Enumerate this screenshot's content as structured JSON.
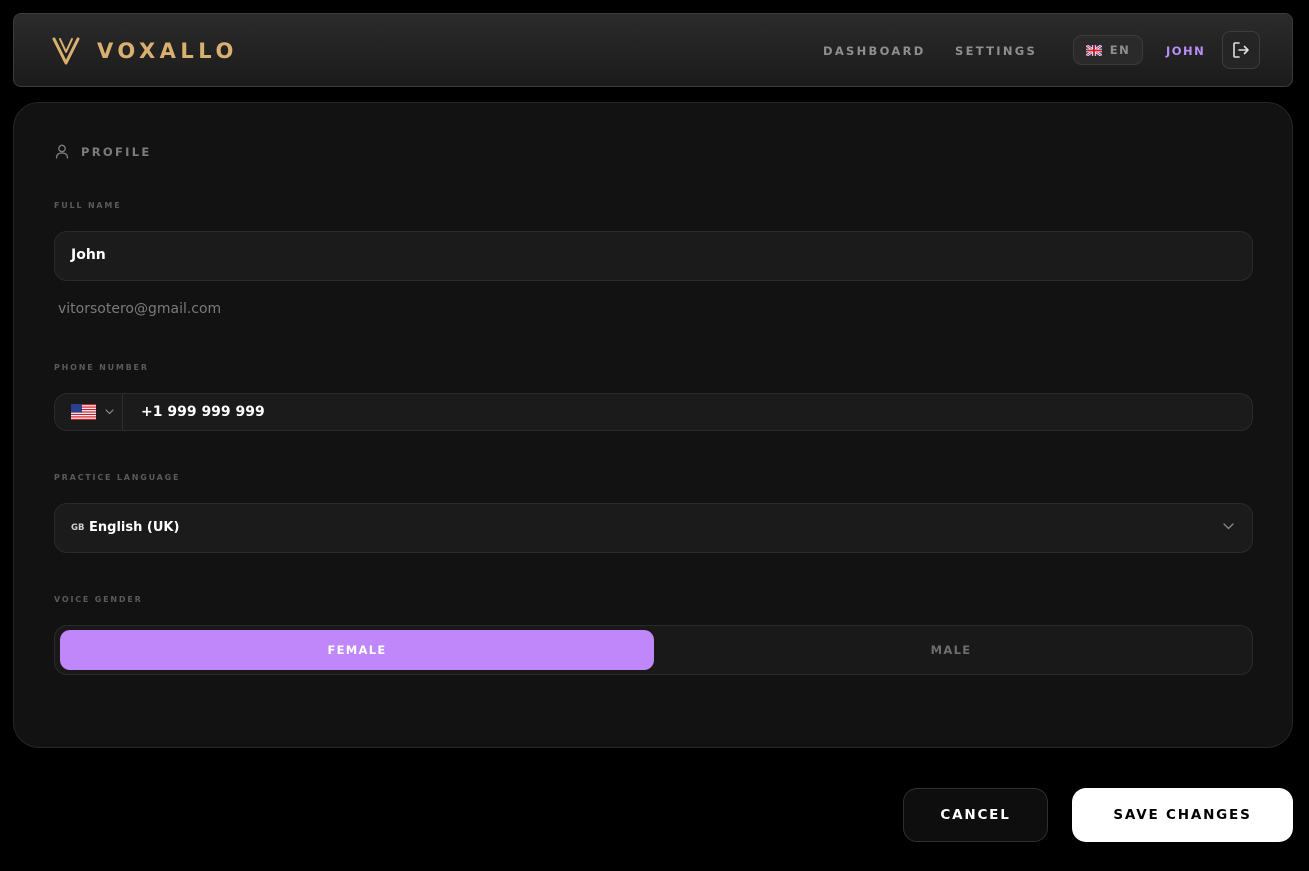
{
  "colors": {
    "brand_gold": "#d9b070",
    "accent_purple": "#c087fb",
    "user_purple": "#b98ef5",
    "background": "#000000",
    "card": "#121212"
  },
  "header": {
    "logo_icon": "v-chevron-logo",
    "brand_name": "VOXALLO",
    "nav": {
      "dashboard": "DASHBOARD",
      "settings": "SETTINGS"
    },
    "language": {
      "flag_icon": "uk-flag-icon",
      "code": "EN"
    },
    "user_name": "JOHN",
    "logout_icon": "logout-icon"
  },
  "profile": {
    "section_icon": "user-icon",
    "section_title": "PROFILE",
    "full_name": {
      "label": "FULL NAME",
      "value": "John"
    },
    "email": "vitorsotero@gmail.com",
    "phone": {
      "label": "PHONE NUMBER",
      "country_flag_icon": "us-flag-icon",
      "value": "+1 999 999 999"
    },
    "practice_language": {
      "label": "PRACTICE LANGUAGE",
      "flag_code": "GB",
      "value": "English (UK)"
    },
    "voice_gender": {
      "label": "VOICE GENDER",
      "options": [
        "FEMALE",
        "MALE"
      ],
      "selected": "FEMALE"
    }
  },
  "actions": {
    "cancel": "CANCEL",
    "save": "SAVE CHANGES"
  }
}
